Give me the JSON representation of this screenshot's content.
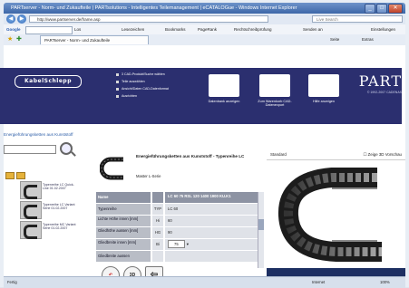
{
  "window": {
    "title": "PARTserver - Norm- und Zukaufteile | PARTsolutions - Intelligentes Teilemanagement | eCATALOGue - Windows Internet Explorer",
    "controls": [
      "_",
      "□",
      "✕"
    ]
  },
  "address_bar": {
    "url": "http://www.partserver.de/frame.asp",
    "search_placeholder": "Live Search"
  },
  "google_toolbar": {
    "brand": "Google",
    "items": [
      "Los",
      "Lesezeichen",
      "Bookmarks",
      "PageRank",
      "Rechtschreibprüfung",
      "Senden an"
    ],
    "settings": "Einstellungen"
  },
  "favorites": {
    "tab_label": "PARTserver - Norm- und Zukaufteile",
    "right_items": [
      "Seite",
      "Extras"
    ]
  },
  "site": {
    "logo": "KabelSchlepp",
    "menu": [
      "3 CAD-Produkt/Suche wählen",
      "Teile auswählen",
      "Ansicht/Daten CAD-Datenformat",
      "Ausrichten"
    ],
    "banner_buttons": [
      "Datenbank anzeigen",
      "Zum Warenkorb CAD-Datenexport",
      "Hilfe anzeigen"
    ],
    "brand": "PART",
    "brand_copyright": "© 1992-2007 CADENAS"
  },
  "left_panel": {
    "title": "Energieführungsketten aus Kunststoff",
    "search_placeholder": "",
    "items": [
      {
        "label": "Typenreihe LC Quick-Line 01.02.2007"
      },
      {
        "label": "Typenreihe LC Variant Serie 01.02.2007"
      },
      {
        "label": "Typenreihe MC Variant Serie 01.02.2007"
      }
    ]
  },
  "product": {
    "title": "Energieführungsketten aus Kunststoff - Typenreihe LC",
    "subtitle": "Master L-Serie",
    "table": [
      {
        "key": "Name",
        "code": "",
        "value": "LC 60 75 RSL 120 1400 1900 KU.K1"
      },
      {
        "key": "Typenreihe",
        "code": "TYP",
        "value": "LC 60"
      },
      {
        "key": "Lichte Höhe innen [mm]",
        "code": "Hi",
        "value": "60"
      },
      {
        "key": "Gliedhöhe aussen [mm]",
        "code": "HG",
        "value": "90"
      },
      {
        "key": "Gliedbreite innen [mm]",
        "code": "Bi",
        "value": "75"
      },
      {
        "key": "Gliedbreite aussen",
        "code": "",
        "value": ""
      }
    ],
    "bottom_icons": [
      "back-icon",
      "3d-icon",
      "forward-icon"
    ],
    "bottom_3d_label": "3D"
  },
  "viewer": {
    "mode": "Standard",
    "show_3d_label": "Zeige 3D Vorschau"
  },
  "statusbar": {
    "left": "Fertig",
    "zone": "Internet",
    "zoom": "100%"
  }
}
